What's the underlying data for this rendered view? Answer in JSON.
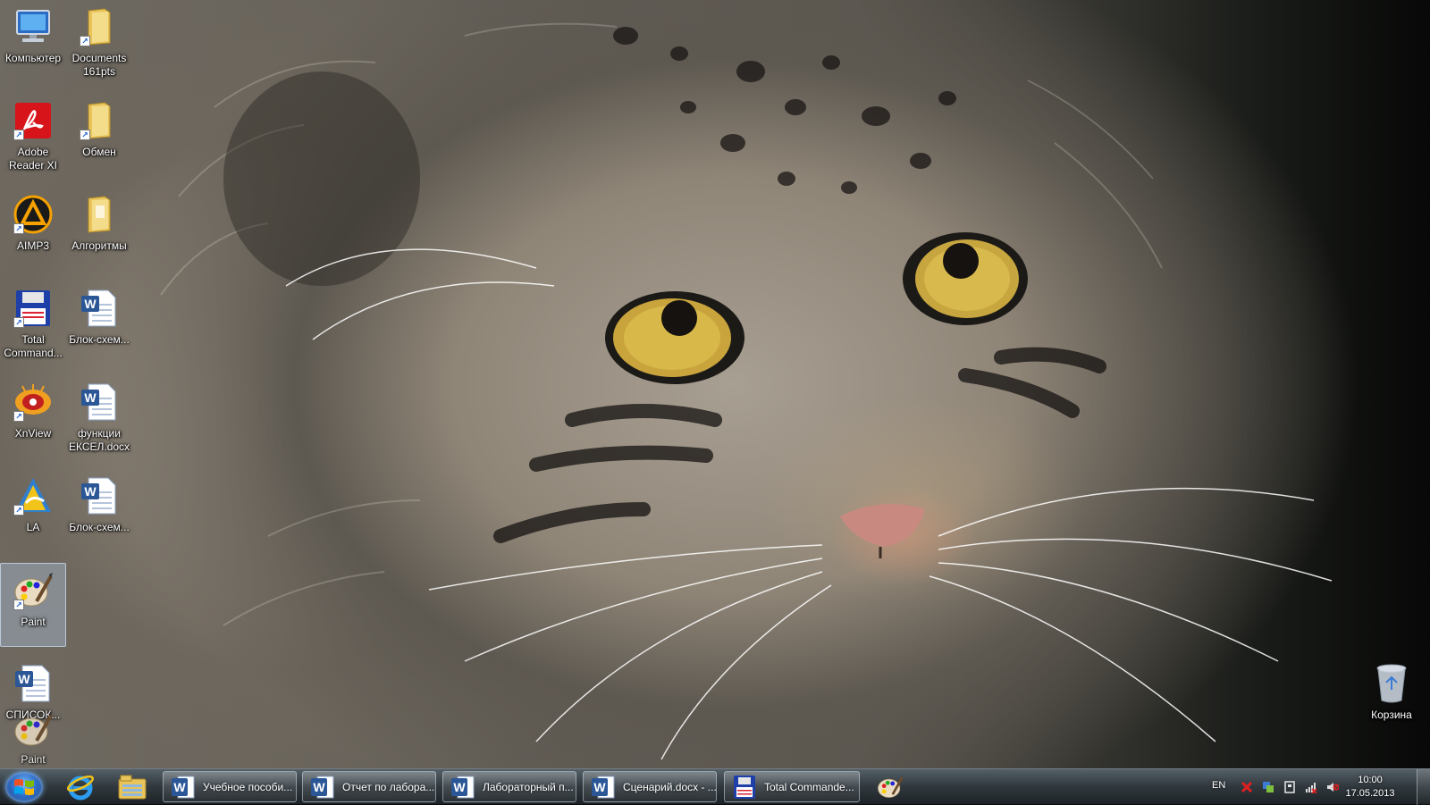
{
  "desktop": {
    "icons": [
      {
        "label": "Компьютер",
        "icon": "computer-icon"
      },
      {
        "label": "Documents 161pts",
        "icon": "folder-icon"
      },
      {
        "label": "Adobe Reader XI",
        "icon": "adobe-reader-icon"
      },
      {
        "label": "Обмен",
        "icon": "folder-icon"
      },
      {
        "label": "AIMP3",
        "icon": "aimp-icon"
      },
      {
        "label": "Алгоритмы",
        "icon": "folder-icon"
      },
      {
        "label": "Total Command...",
        "icon": "total-commander-icon"
      },
      {
        "label": "Блок-схем...",
        "icon": "word-document-icon"
      },
      {
        "label": "XnView",
        "icon": "xnview-icon"
      },
      {
        "label": "функции ЕКСЕЛ.docx",
        "icon": "word-document-icon"
      },
      {
        "label": "LA",
        "icon": "la-icon"
      },
      {
        "label": "Блок-схем...",
        "icon": "word-document-icon"
      },
      {
        "label": "Paint",
        "icon": "paint-icon"
      },
      {
        "label": "СПИСОК...",
        "icon": "word-document-icon"
      },
      {
        "label": "Paint",
        "icon": "paint-icon"
      }
    ],
    "recycle_bin": {
      "label": "Корзина",
      "icon": "recycle-bin-icon"
    }
  },
  "taskbar": {
    "pinned": [
      {
        "name": "internet-explorer",
        "icon": "internet-explorer-icon"
      },
      {
        "name": "explorer",
        "icon": "file-explorer-icon"
      }
    ],
    "tasks": [
      {
        "label": "Учебное пособи...",
        "icon": "word-icon"
      },
      {
        "label": "Отчет по лабора...",
        "icon": "word-icon"
      },
      {
        "label": "Лабораторный п...",
        "icon": "word-icon"
      },
      {
        "label": "Сценарий.docx - ...",
        "icon": "word-icon"
      },
      {
        "label": "Total Commande...",
        "icon": "total-commander-icon"
      }
    ],
    "paint_pinned": {
      "icon": "paint-icon"
    },
    "tray": {
      "language": "EN",
      "time": "10:00",
      "date": "17.05.2013"
    }
  },
  "colors": {
    "word_blue": "#2b5797",
    "adobe_red": "#d8141b",
    "folder_yellow": "#e8c45a",
    "aimp_orange": "#f5a200"
  }
}
